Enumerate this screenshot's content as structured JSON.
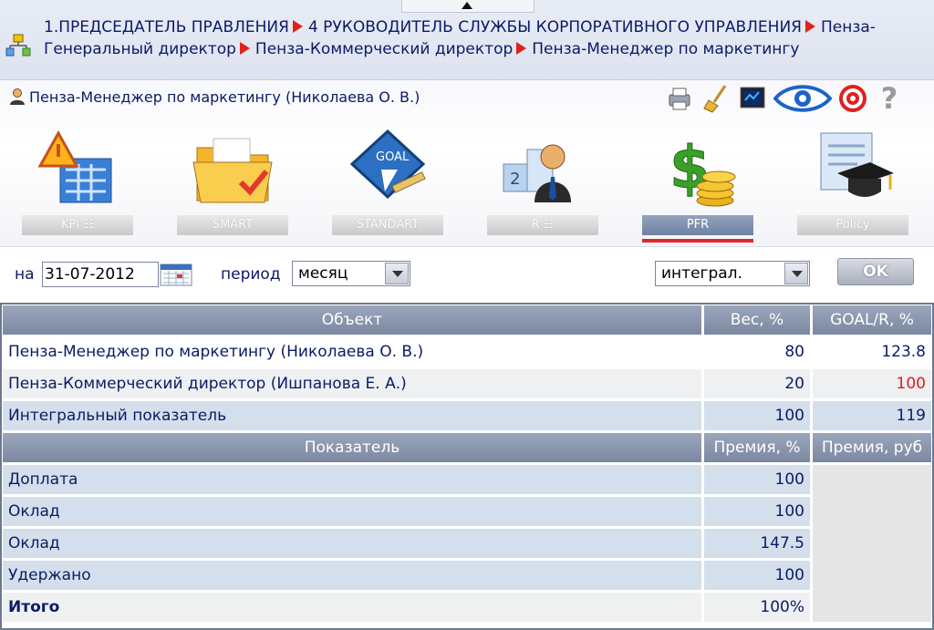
{
  "breadcrumb": {
    "items": [
      "1.ПРЕДСЕДАТЕЛЬ ПРАВЛЕНИЯ",
      "4 РУКОВОДИТЕЛЬ СЛУЖБЫ КОРПОРАТИВНОГО УПРАВЛЕНИЯ",
      "Пенза-Генеральный директор",
      "Пенза-Коммерческий директор",
      "Пенза-Менеджер по маркетингу"
    ]
  },
  "user": {
    "name": "Пенза-Менеджер по маркетингу  (Николаева О. В.)"
  },
  "toolbar": {
    "icons": [
      "printer-icon",
      "broom-icon",
      "monitor-icon",
      "eye-icon",
      "target-icon",
      "help-icon"
    ],
    "help_glyph": "?"
  },
  "modules": [
    {
      "label": "KPI  ☷",
      "icon": "kpi-warning-icon"
    },
    {
      "label": "SMART",
      "icon": "folder-icon"
    },
    {
      "label": "STANDART",
      "icon": "goal-icon"
    },
    {
      "label": "R  ☷",
      "icon": "ranking-icon"
    },
    {
      "label": "PFR",
      "icon": "dollar-coins-icon",
      "active": true
    },
    {
      "label": "Policy",
      "icon": "diploma-icon"
    }
  ],
  "filters": {
    "date_label": "на",
    "date_value": "31-07-2012",
    "period_label": "период",
    "period_value": "месяц",
    "mode_value": "интеграл.",
    "ok_label": "OK"
  },
  "objects_table": {
    "headers": [
      "Объект",
      "Вес, %",
      "GOAL/R, %"
    ],
    "rows": [
      {
        "name": "Пенза-Менеджер по маркетингу (Николаева О. В.)",
        "weight": "80",
        "goal": "123.8"
      },
      {
        "name": "Пенза-Коммерческий директор (Ишпанова Е. А.)",
        "weight": "20",
        "goal": "100"
      },
      {
        "name": "Интегральный показатель",
        "weight": "100",
        "goal": "119"
      }
    ]
  },
  "bonus_table": {
    "headers": [
      "Показатель",
      "Премия, %",
      "Премия, руб"
    ],
    "rows": [
      {
        "name": "Доплата",
        "percent": "100"
      },
      {
        "name": "Оклад",
        "percent": "100"
      },
      {
        "name": "Оклад",
        "percent": "147.5"
      },
      {
        "name": "Удержано",
        "percent": "100"
      },
      {
        "name": "Итого",
        "percent": "100%"
      }
    ]
  },
  "colors": {
    "accent_red": "#e3262a",
    "header_blue": "#7b88a1",
    "row_blue": "#d4dfec"
  }
}
